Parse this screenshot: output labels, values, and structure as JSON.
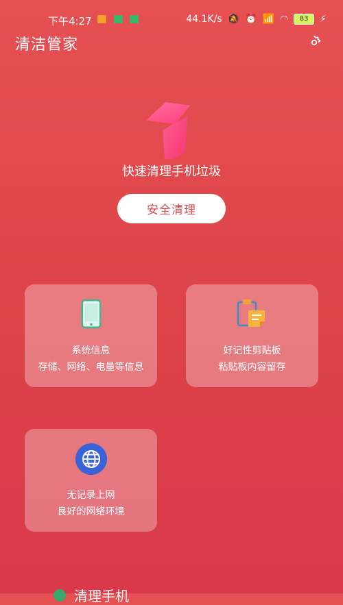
{
  "status_bar": {
    "time": "下午4:27",
    "net_speed": "44.1K/s",
    "battery": "83",
    "notif_colors": [
      "#f3a12a",
      "#3bb56c",
      "#3bb56c"
    ]
  },
  "header": {
    "title": "清洁管家"
  },
  "hero": {
    "title": "快速清理手机垃圾",
    "button_label": "安全清理"
  },
  "cards": [
    {
      "title": "系统信息",
      "subtitle": "存储、网络、电量等信息",
      "icon": "phone-icon"
    },
    {
      "title": "好记性剪贴板",
      "subtitle": "粘贴板内容留存",
      "icon": "clipboard-icon"
    },
    {
      "title": "无记录上网",
      "subtitle": "良好的网络环境",
      "icon": "globe-icon"
    }
  ],
  "bottom": {
    "label": "清理手机"
  },
  "colors": {
    "accent": "#e04a4f",
    "hero_pink": "#ff4f86"
  }
}
